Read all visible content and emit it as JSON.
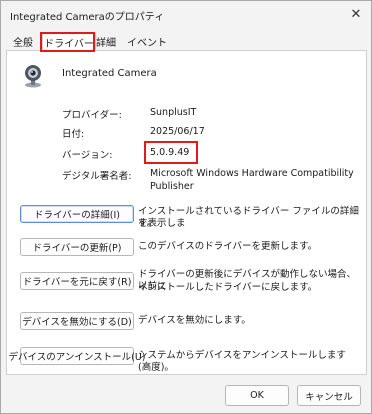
{
  "window": {
    "title": "Integrated Cameraのプロパティ",
    "close_glyph": "✕"
  },
  "tabs": [
    {
      "label": "全般"
    },
    {
      "label": "ドライバー",
      "active": true
    },
    {
      "label": "詳細"
    },
    {
      "label": "イベント"
    }
  ],
  "device": {
    "name": "Integrated Camera",
    "icon": "webcam-icon"
  },
  "properties": {
    "provider_label": "プロバイダー:",
    "provider_value": "SunplusIT",
    "date_label": "日付:",
    "date_value": "2025/06/17",
    "version_label": "バージョン:",
    "version_value": "5.0.9.49",
    "signer_label": "デジタル署名者:",
    "signer_value_line1": "Microsoft Windows Hardware Compatibility",
    "signer_value_line2": "Publisher"
  },
  "actions": [
    {
      "button": "ドライバーの詳細(I)",
      "desc1": "インストールされているドライバー ファイルの詳細を表示しま",
      "desc2": "す。"
    },
    {
      "button": "ドライバーの更新(P)",
      "desc1": "このデバイスのドライバーを更新します。",
      "desc2": ""
    },
    {
      "button": "ドライバーを元に戻す(R)",
      "desc1": "ドライバーの更新後にデバイスが動作しない場合、以前に",
      "desc2": "インストールしたドライバーに戻します。"
    },
    {
      "button": "デバイスを無効にする(D)",
      "desc1": "デバイスを無効にします。",
      "desc2": ""
    },
    {
      "button": "デバイスのアンインストール(U)",
      "desc1": "システムからデバイスをアンインストールします (高度)。",
      "desc2": ""
    }
  ],
  "footer": {
    "ok": "OK",
    "cancel": "キャンセル"
  },
  "colors": {
    "highlight": "#e01b1b"
  }
}
